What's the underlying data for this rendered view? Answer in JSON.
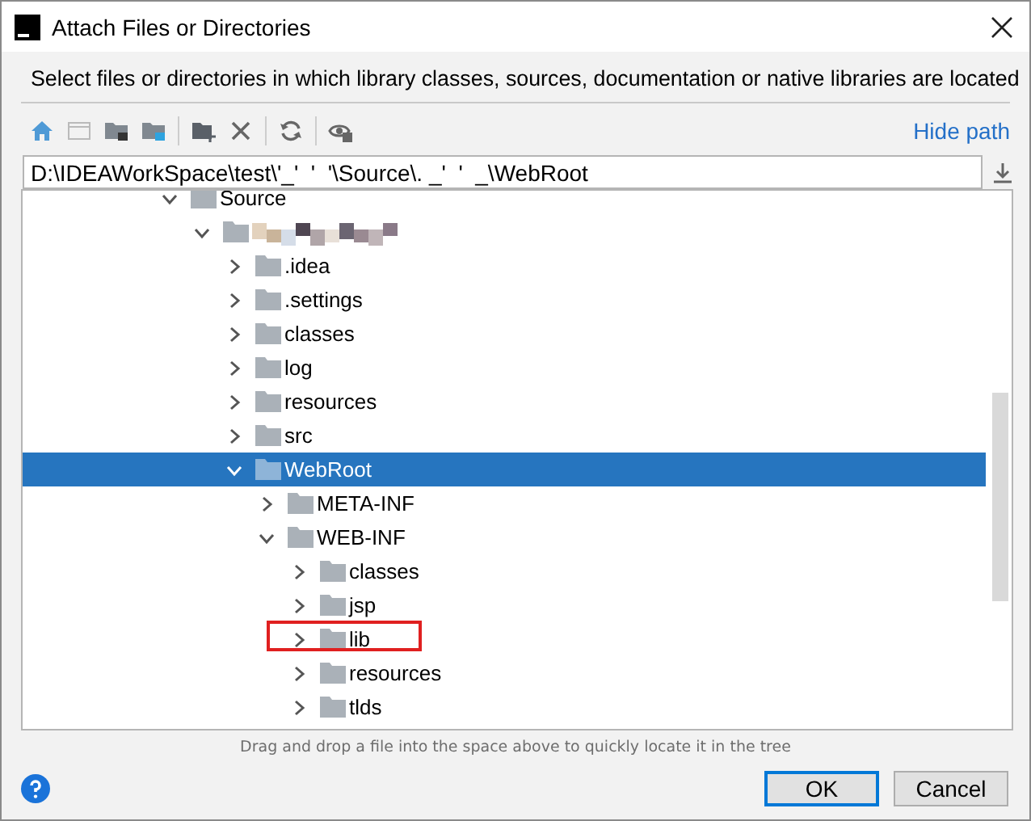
{
  "window": {
    "title": "Attach Files or Directories"
  },
  "description": "Select files or directories in which library classes, sources, documentation or native libraries are located",
  "toolbar": {
    "groups": [
      [
        {
          "kind": "home",
          "disabled": false
        },
        {
          "kind": "desktop",
          "disabled": true
        },
        {
          "kind": "project",
          "disabled": false
        },
        {
          "kind": "module",
          "disabled": false
        }
      ],
      [
        {
          "kind": "new-folder",
          "disabled": false
        },
        {
          "kind": "delete",
          "disabled": false
        }
      ],
      [
        {
          "kind": "refresh",
          "disabled": false
        }
      ],
      [
        {
          "kind": "hidden",
          "disabled": false
        }
      ]
    ],
    "link": "Hide path"
  },
  "path_field": {
    "value": "D:\\IDEAWorkSpace\\test\\'_'  '  '\\Source\\. _'  '  _\\WebRoot"
  },
  "tree": [
    {
      "kind": "folder",
      "name": "Source",
      "expanded": true,
      "selected": false,
      "highlighted": false,
      "children": [
        {
          "kind": "redacted",
          "expanded": true,
          "selected": false,
          "highlighted": false,
          "children": [
            {
              "kind": "folder",
              "name": ".idea",
              "expanded": false,
              "selected": false,
              "highlighted": false
            },
            {
              "kind": "folder",
              "name": ".settings",
              "expanded": false,
              "selected": false,
              "highlighted": false
            },
            {
              "kind": "folder",
              "name": "classes",
              "expanded": false,
              "selected": false,
              "highlighted": false
            },
            {
              "kind": "folder",
              "name": "log",
              "expanded": false,
              "selected": false,
              "highlighted": false
            },
            {
              "kind": "folder",
              "name": "resources",
              "expanded": false,
              "selected": false,
              "highlighted": false
            },
            {
              "kind": "folder",
              "name": "src",
              "expanded": false,
              "selected": false,
              "highlighted": false
            },
            {
              "kind": "folder",
              "name": "WebRoot",
              "expanded": true,
              "selected": true,
              "highlighted": false,
              "children": [
                {
                  "kind": "folder",
                  "name": "META-INF",
                  "expanded": false,
                  "selected": false,
                  "highlighted": false
                },
                {
                  "kind": "folder",
                  "name": "WEB-INF",
                  "expanded": true,
                  "selected": false,
                  "highlighted": false,
                  "children": [
                    {
                      "kind": "folder",
                      "name": "classes",
                      "expanded": false,
                      "selected": false,
                      "highlighted": false
                    },
                    {
                      "kind": "folder",
                      "name": "jsp",
                      "expanded": false,
                      "selected": false,
                      "highlighted": false
                    },
                    {
                      "kind": "folder",
                      "name": "lib",
                      "expanded": false,
                      "selected": false,
                      "highlighted": true
                    },
                    {
                      "kind": "folder",
                      "name": "resources",
                      "expanded": false,
                      "selected": false,
                      "highlighted": false
                    },
                    {
                      "kind": "folder",
                      "name": "tlds",
                      "expanded": false,
                      "selected": false,
                      "highlighted": false
                    }
                  ]
                }
              ]
            }
          ]
        }
      ]
    }
  ],
  "hint": "Drag and drop a file into the space above to quickly locate it in the tree",
  "buttons": [
    {
      "label": "OK",
      "default": true
    },
    {
      "label": "Cancel",
      "default": false
    }
  ]
}
